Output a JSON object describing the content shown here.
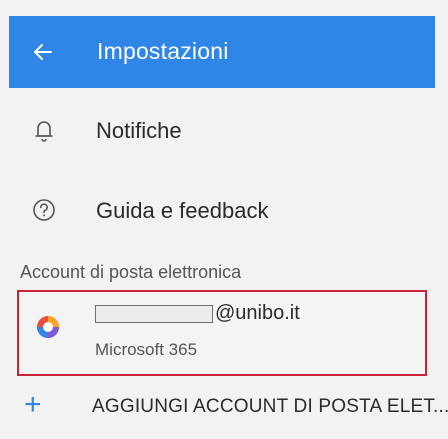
{
  "header": {
    "title": "Impostazioni",
    "back_icon": "arrow-left-icon",
    "background": "#2f86e6"
  },
  "menu": [
    {
      "label": "Notifiche",
      "icon": "bell-icon"
    },
    {
      "label": "Guida e feedback",
      "icon": "help-circle-icon"
    }
  ],
  "accounts_section": {
    "header": "Account di posta elettronica",
    "account": {
      "email_suffix": "@unibo.it",
      "provider": "Microsoft 365",
      "logo_icon": "office365-logo-icon"
    }
  },
  "add_account": {
    "label": "AGGIUNGI ACCOUNT DI POSTA ELET...",
    "icon": "plus-icon"
  },
  "colors": {
    "accent": "#2f86e6",
    "highlight_border": "#c8233a"
  }
}
